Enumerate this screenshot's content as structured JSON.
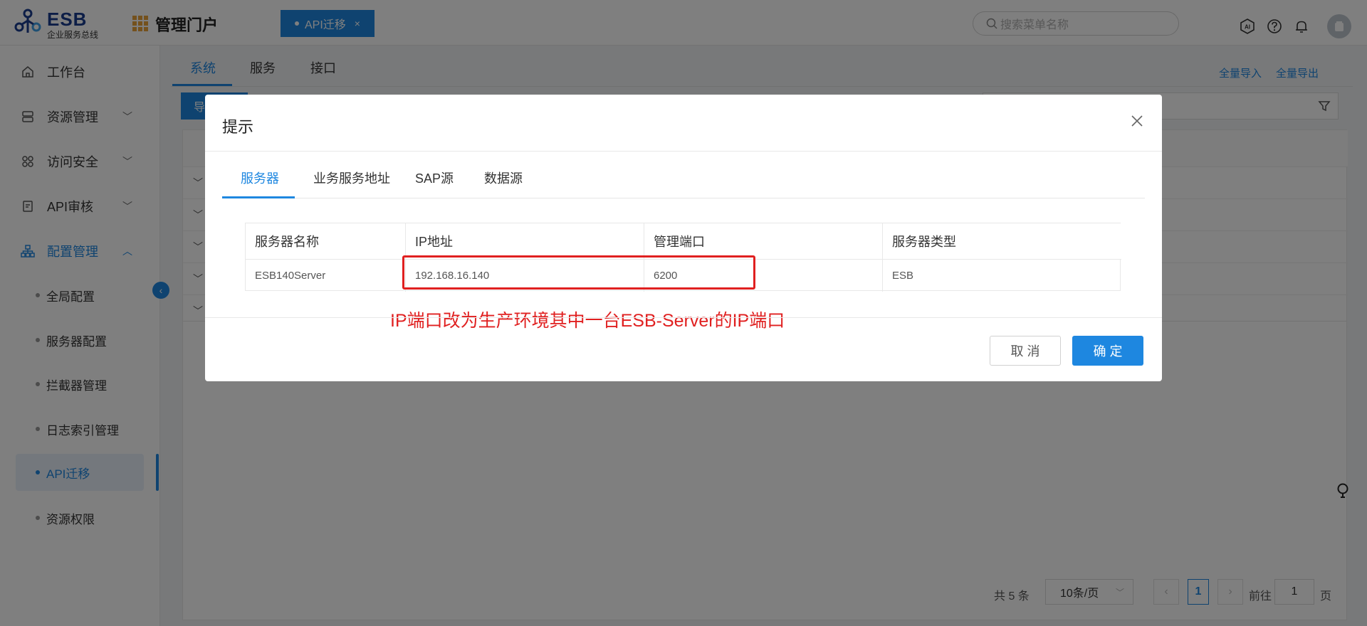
{
  "header": {
    "logo_title": "ESB",
    "logo_subtitle": "企业服务总线",
    "portal_title": "管理门户",
    "open_tab": "API迁移",
    "open_tab_close": "×",
    "search_placeholder": "搜索菜单名称"
  },
  "sidebar": {
    "items": [
      {
        "label": "工作台",
        "icon": "home-icon"
      },
      {
        "label": "资源管理",
        "icon": "database-icon",
        "chevron": "﹀"
      },
      {
        "label": "访问安全",
        "icon": "grid-icon",
        "chevron": "﹀"
      },
      {
        "label": "API审核",
        "icon": "document-icon",
        "chevron": "﹀"
      },
      {
        "label": "配置管理",
        "icon": "org-chart-icon",
        "chevron": "︿"
      }
    ],
    "sub_items": [
      {
        "label": "全局配置"
      },
      {
        "label": "服务器配置"
      },
      {
        "label": "拦截器管理"
      },
      {
        "label": "日志索引管理"
      },
      {
        "label": "API迁移",
        "active": true
      },
      {
        "label": "资源权限"
      }
    ],
    "collapse_symbol": "‹"
  },
  "main": {
    "tabs": [
      {
        "label": "系统"
      },
      {
        "label": "服务"
      },
      {
        "label": "接口"
      }
    ],
    "import_all": "全量导入",
    "export_all": "全量导出",
    "action_button": "导",
    "row_chevron": "﹀",
    "pagination": {
      "total": "共 5 条",
      "page_size": "10条/页",
      "size_chevron": "﹀",
      "prev": "‹",
      "current_page": "1",
      "next": "›",
      "goto_label": "前往",
      "goto_value": "1",
      "page_label": "页"
    }
  },
  "modal": {
    "title": "提示",
    "tabs": [
      {
        "label": "服务器"
      },
      {
        "label": "业务服务地址"
      },
      {
        "label": "SAP源"
      },
      {
        "label": "数据源"
      }
    ],
    "table": {
      "headers": [
        "服务器名称",
        "IP地址",
        "管理端口",
        "服务器类型"
      ],
      "rows": [
        [
          "ESB140Server",
          "192.168.16.140",
          "6200",
          "ESB"
        ]
      ]
    },
    "annotation": "IP端口改为生产环境其中一台ESB-Server的IP端口",
    "cancel": "取 消",
    "confirm": "确 定"
  },
  "colors": {
    "accent": "#1e87e0",
    "annotation_red": "#e02020",
    "overlay": "rgba(0,0,0,0.5)"
  }
}
